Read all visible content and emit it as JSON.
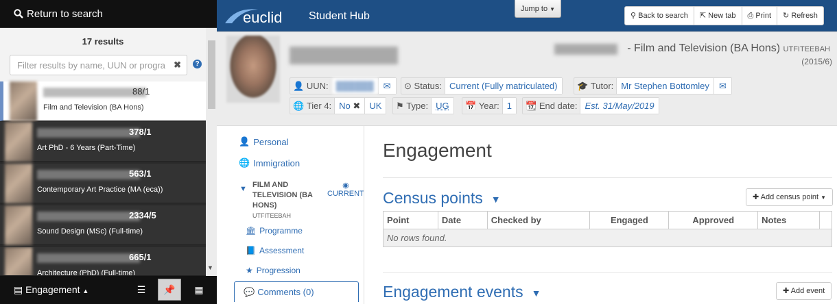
{
  "sidebar": {
    "return_label": "Return to search",
    "results_count": "17 results",
    "filter_placeholder": "Filter results by name, UUN or progra",
    "results": [
      {
        "id_suffix": "88/1",
        "programme": "Film and Television (BA Hons)"
      },
      {
        "id_suffix": "378/1",
        "programme": "Art PhD - 6 Years (Part-Time)"
      },
      {
        "id_suffix": "563/1",
        "programme": "Contemporary Art Practice (MA (eca))"
      },
      {
        "id_suffix": "2334/5",
        "programme": "Sound Design (MSc) (Full-time)"
      },
      {
        "id_suffix": "665/1",
        "programme": "Architecture (PhD) (Full-time)"
      }
    ],
    "view_label": "Engagement"
  },
  "topbar": {
    "logo_text": "euclid",
    "hub_title": "Student Hub",
    "jump_label": "Jump to",
    "buttons": {
      "back": "Back to search",
      "newtab": "New tab",
      "print": "Print",
      "refresh": "Refresh"
    }
  },
  "student": {
    "programme": "- Film and Television (BA Hons)",
    "programme_code": "UTFITEEBAH",
    "session": "(2015/6)",
    "uun_label": "UUN:",
    "status_label": "Status:",
    "status_value": "Current (Fully matriculated)",
    "tutor_label": "Tutor:",
    "tutor_value": "Mr Stephen Bottomley",
    "tier4_label": "Tier 4:",
    "tier4_value": "No",
    "tier4_country": "UK",
    "type_label": "Type:",
    "type_value": "UG",
    "year_label": "Year:",
    "year_value": "1",
    "enddate_label": "End date:",
    "enddate_value": "Est. 31/May/2019"
  },
  "nav": {
    "personal": "Personal",
    "immigration": "Immigration",
    "section_title": "FILM AND TELEVISION (BA HONS)",
    "section_code": "UTFITEEBAH",
    "current_label": "CURRENT",
    "programme": "Programme",
    "assessment": "Assessment",
    "progression": "Progression",
    "comments": "Comments (0)"
  },
  "main": {
    "title": "Engagement",
    "census_title": "Census points",
    "add_census": "Add census point",
    "columns": [
      "Point",
      "Date",
      "Checked by",
      "Engaged",
      "Approved",
      "Notes"
    ],
    "empty_text": "No rows found.",
    "events_title": "Engagement events",
    "add_event": "Add event"
  },
  "colors": {
    "brand": "#1e4f85",
    "link": "#2f6db3"
  }
}
